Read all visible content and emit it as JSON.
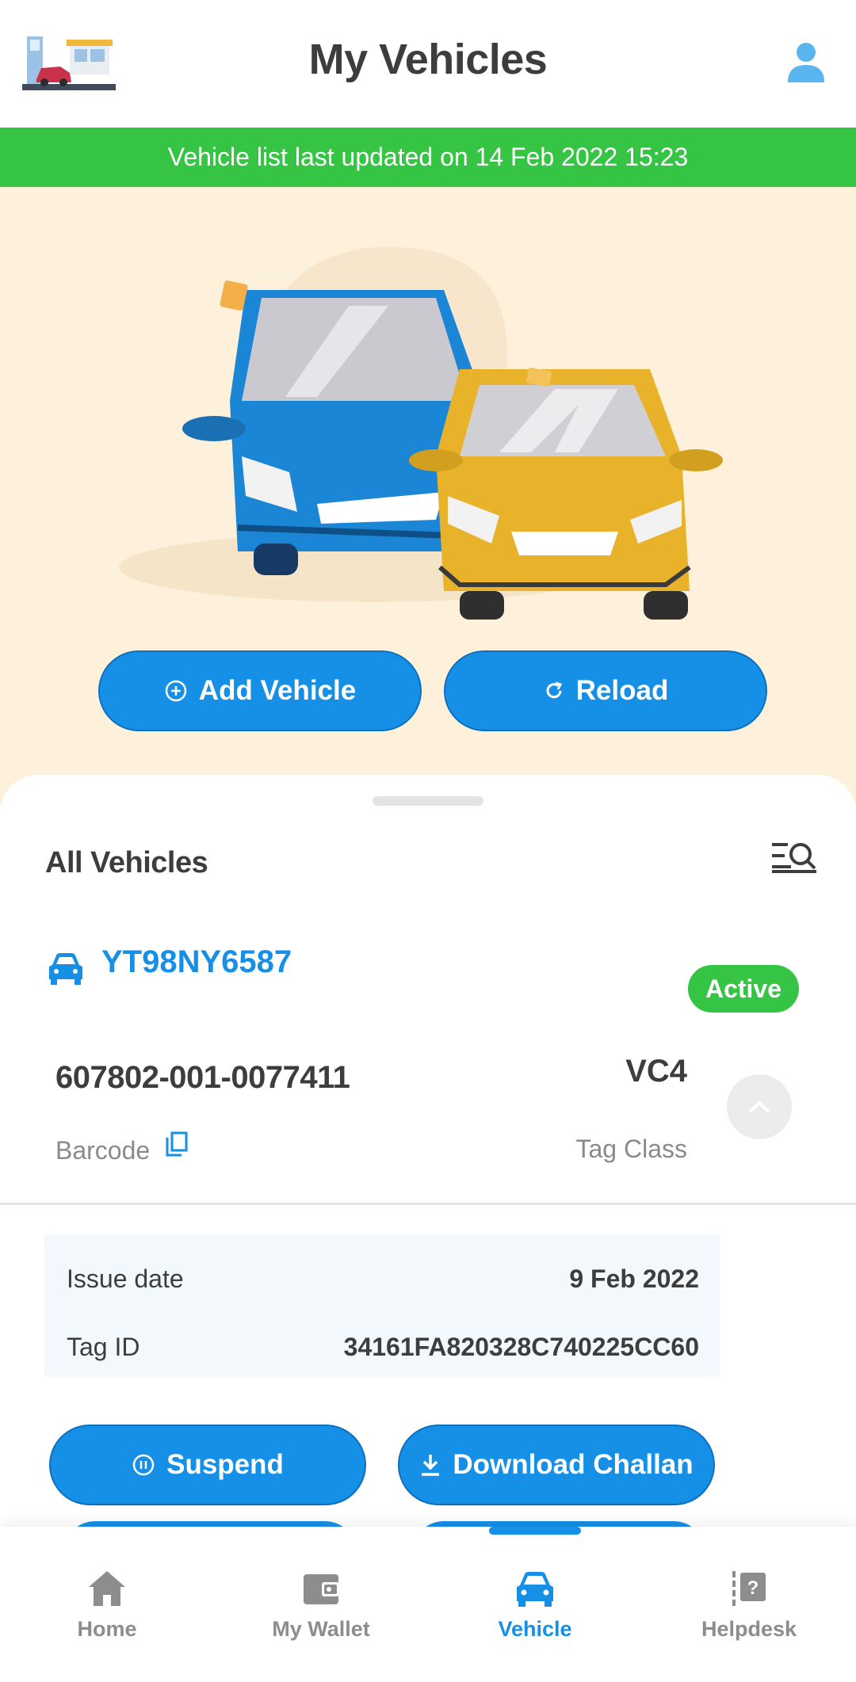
{
  "header": {
    "title": "My Vehicles"
  },
  "banner": {
    "text": "Vehicle list last updated on 14 Feb 2022 15:23"
  },
  "hero": {
    "add_label": "Add Vehicle",
    "reload_label": "Reload"
  },
  "vehicles": {
    "title": "All Vehicles",
    "items": [
      {
        "number": "YT98NY6587",
        "status": "Active",
        "barcode": "607802-001-0077411",
        "barcode_label": "Barcode",
        "tag_class": "VC4",
        "tag_class_label": "Tag Class",
        "issue_date_label": "Issue date",
        "issue_date": "9 Feb 2022",
        "tag_id_label": "Tag ID",
        "tag_id": "34161FA820328C740225CC60",
        "suspend_label": "Suspend",
        "challan_label": "Download Challan"
      }
    ]
  },
  "nav": {
    "items": [
      {
        "label": "Home",
        "icon": "home-icon"
      },
      {
        "label": "My Wallet",
        "icon": "wallet-icon"
      },
      {
        "label": "Vehicle",
        "icon": "car-icon",
        "active": true
      },
      {
        "label": "Helpdesk",
        "icon": "helpdesk-icon"
      }
    ]
  },
  "colors": {
    "primary": "#1590e6",
    "success": "#36c444",
    "hero_bg": "#fdf1dc"
  }
}
